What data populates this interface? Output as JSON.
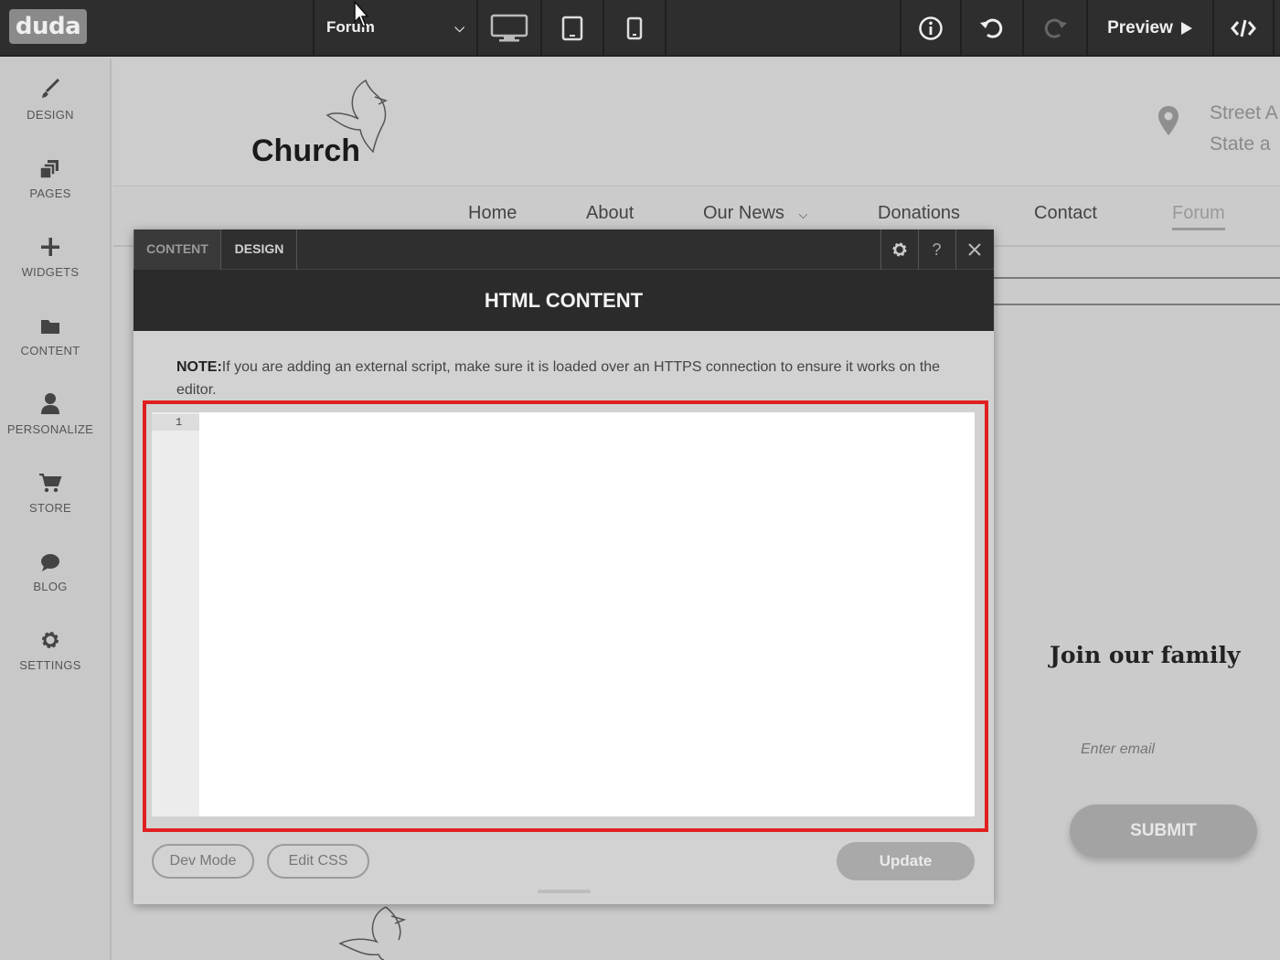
{
  "topbar": {
    "logo": "duda",
    "page_select": "Forum",
    "devices": [
      "desktop-icon",
      "tablet-icon",
      "mobile-icon"
    ],
    "preview_label": "Preview"
  },
  "sidebar": {
    "items": [
      {
        "label": "DESIGN",
        "icon": "brush-icon"
      },
      {
        "label": "PAGES",
        "icon": "pages-icon"
      },
      {
        "label": "WIDGETS",
        "icon": "plus-icon"
      },
      {
        "label": "CONTENT",
        "icon": "folder-icon"
      },
      {
        "label": "PERSONALIZE",
        "icon": "user-icon"
      },
      {
        "label": "STORE",
        "icon": "cart-icon"
      },
      {
        "label": "BLOG",
        "icon": "chat-icon"
      },
      {
        "label": "SETTINGS",
        "icon": "gear-icon"
      }
    ]
  },
  "site": {
    "title": "Church",
    "address_line1": "Street A",
    "address_line2": "State a",
    "nav": [
      "Home",
      "About",
      "Our News",
      "Donations",
      "Contact",
      "Forum"
    ],
    "join_title": "Join our family",
    "email_placeholder": "Enter email",
    "submit_label": "SUBMIT"
  },
  "modal": {
    "tabs": [
      "CONTENT",
      "DESIGN"
    ],
    "help_label": "?",
    "header": "HTML CONTENT",
    "note_bold": "NOTE:",
    "note_text": "If you are adding an external script, make sure it is loaded over an HTTPS connection to ensure it works on the editor.",
    "editor_line": "1",
    "dev_mode_label": "Dev Mode",
    "edit_css_label": "Edit CSS",
    "update_label": "Update"
  },
  "colors": {
    "highlight": "#e02020",
    "topbar": "#2e2e2e",
    "background": "#cbcbcb"
  }
}
